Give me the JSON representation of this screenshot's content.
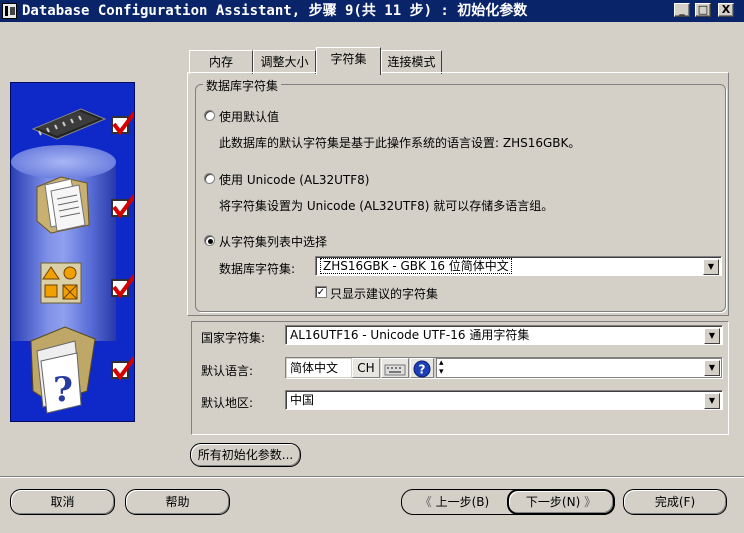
{
  "window": {
    "title": "Database Configuration Assistant, 步骤 9(共 11 步) : 初始化参数",
    "minimize": "_",
    "maximize": "□",
    "close": "X"
  },
  "tabs": [
    {
      "label": "内存",
      "active": false
    },
    {
      "label": "调整大小",
      "active": false
    },
    {
      "label": "字符集",
      "active": true
    },
    {
      "label": "连接模式",
      "active": false
    }
  ],
  "charset_group": {
    "legend": "数据库字符集",
    "option_default": "使用默认值",
    "option_default_desc": "此数据库的默认字符集是基于此操作系统的语言设置: ZHS16GBK。",
    "option_unicode": "使用 Unicode (AL32UTF8)",
    "option_unicode_desc": "将字符集设置为 Unicode (AL32UTF8) 就可以存储多语言组。",
    "option_list": "从字符集列表中选择",
    "selected_option": "option_list",
    "db_charset_label": "数据库字符集:",
    "db_charset_value": "ZHS16GBK - GBK 16 位简体中文",
    "show_recommended_label": "只显示建议的字符集",
    "show_recommended_checked": true
  },
  "national": {
    "national_charset_label": "国家字符集:",
    "national_charset_value": "AL16UTF16 - Unicode UTF-16 通用字符集",
    "default_language_label": "默认语言:",
    "default_language_value": "简体中文",
    "language_code": "CH",
    "default_territory_label": "默认地区:",
    "default_territory_value": "中国"
  },
  "all_params_button": "所有初始化参数...",
  "buttons": {
    "cancel": "取消",
    "help": "帮助",
    "back": "上一步(B)",
    "next": "下一步(N)",
    "finish": "完成(F)"
  },
  "colors": {
    "titlebar": "#0a246a",
    "illustration_bg": "#0f29c8",
    "checkmark": "#d40000",
    "dialog_bg": "#d4d0c8"
  }
}
